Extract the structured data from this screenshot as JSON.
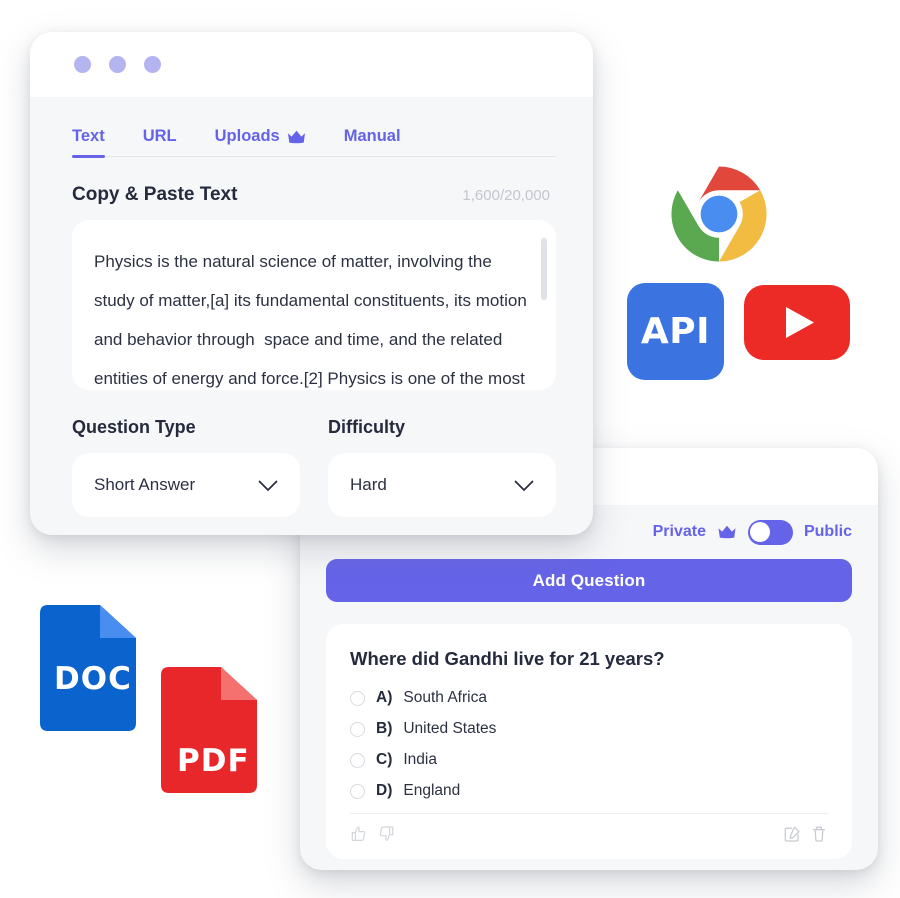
{
  "theme": {
    "accent": "#6563e8",
    "card_bg": "#f6f7f9",
    "panel_white": "#ffffff",
    "text_dark": "#252a3d",
    "text_muted": "#c3c6cf",
    "chrome_red": "#e1483b",
    "chrome_yellow": "#f2bc42",
    "chrome_green": "#5aa84f",
    "chrome_blue": "#4a8df0",
    "api_blue": "#3b73e0",
    "youtube_red": "#ec2a26",
    "doc_blue": "#0b63ce",
    "pdf_red": "#e8272b"
  },
  "generator": {
    "window_dots": [
      "dot-1",
      "dot-2",
      "dot-3"
    ],
    "tabs": [
      {
        "label": "Text",
        "active": true,
        "icon": null
      },
      {
        "label": "URL",
        "active": false,
        "icon": null
      },
      {
        "label": "Uploads",
        "active": false,
        "icon": "crown-icon"
      },
      {
        "label": "Manual",
        "active": false,
        "icon": null
      }
    ],
    "section_title": "Copy & Paste Text",
    "counter": "1,600/20,000",
    "textarea_value": "Physics is the natural science of matter, involving the study of matter,[a] its fundamental constituents, its motion and behavior through  space and time, and the related entities of energy and force.[2] Physics is one of the most fundamental scientific disciplines, with its main goal being",
    "fields": [
      {
        "label": "Question Type",
        "value": "Short Answer",
        "icon": "chevron-down-icon"
      },
      {
        "label": "Difficulty",
        "value": "Hard",
        "icon": "chevron-down-icon"
      }
    ]
  },
  "questions": {
    "visibility": {
      "left_label": "Private",
      "right_label": "Public",
      "crown_icon": "crown-icon",
      "toggle_state": "private"
    },
    "add_button": "Add Question",
    "question": {
      "title": "Where did Gandhi live for 21 years?",
      "options": [
        {
          "letter": "A)",
          "text": "South Africa"
        },
        {
          "letter": "B)",
          "text": "United States"
        },
        {
          "letter": "C)",
          "text": "India"
        },
        {
          "letter": "D)",
          "text": "England"
        }
      ],
      "footer_icons": {
        "thumbs_up": "thumbs-up-icon",
        "thumbs_down": "thumbs-down-icon",
        "edit": "edit-icon",
        "delete": "trash-icon"
      }
    }
  },
  "logos": {
    "chrome": "chrome-logo",
    "api": "API",
    "youtube": "youtube-logo",
    "doc": "DOC",
    "pdf": "PDF"
  }
}
